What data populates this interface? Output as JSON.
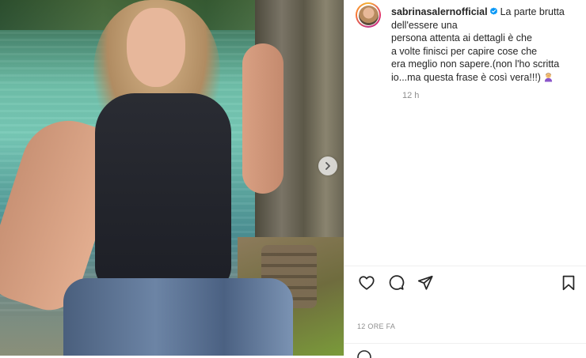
{
  "post": {
    "username": "sabrinasalernofficial",
    "verified": true,
    "caption_lines": [
      "La parte brutta",
      "dell'essere una",
      "persona attenta ai dettagli è che",
      "a volte finisci per capire cose che",
      "era meglio non sapere.(non l'ho scritta",
      "io...ma questa frase è così vera!!!)"
    ],
    "caption_emoji": "person-facepalming",
    "time_ago": "12 h",
    "date_label": "12 ORE FA"
  },
  "icons": {
    "like": "heart-icon",
    "comment": "comment-bubble-icon",
    "share": "paper-plane-icon",
    "save": "bookmark-icon",
    "next": "chevron-right-icon",
    "verified": "verified-badge-icon"
  },
  "colors": {
    "verified_blue": "#0095f6",
    "text_primary": "#262626",
    "text_secondary": "#8e8e8e",
    "divider": "#efefef"
  }
}
